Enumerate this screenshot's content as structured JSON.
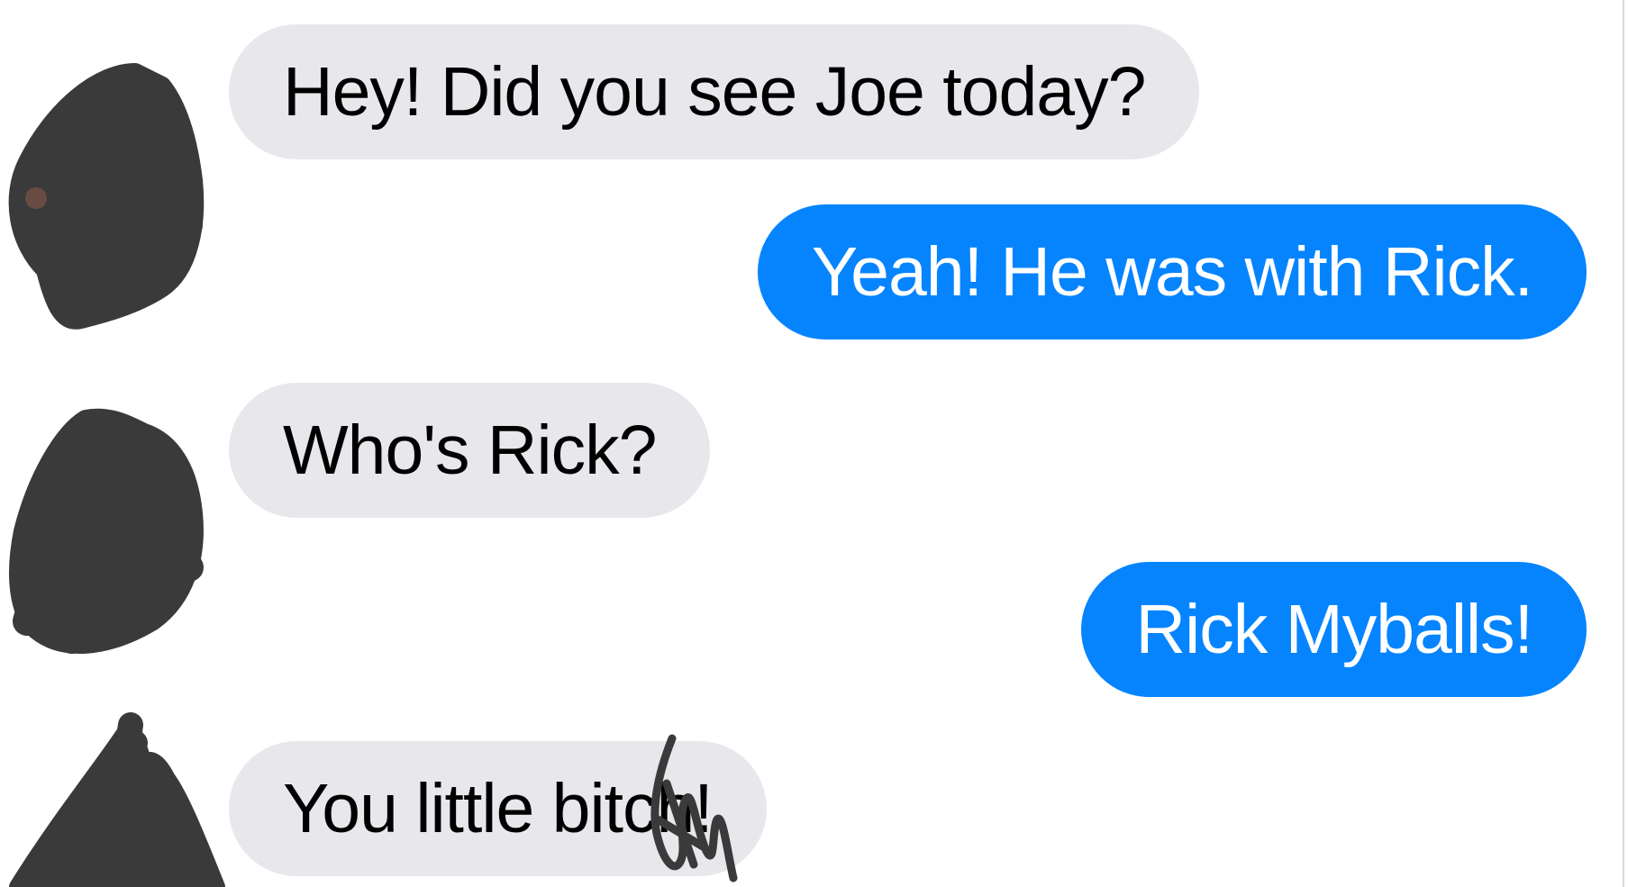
{
  "colors": {
    "background": "#ffffff",
    "incoming_bubble": "#e8e8ec",
    "outgoing_bubble": "#0584fe",
    "scribble": "#3a3a3a"
  },
  "messages": [
    {
      "sender": "contact",
      "text": "Hey! Did you see Joe today?"
    },
    {
      "sender": "me",
      "text": "Yeah! He was with Rick."
    },
    {
      "sender": "contact",
      "text": "Who's Rick?"
    },
    {
      "sender": "me",
      "text": "Rick Myballs!"
    },
    {
      "sender": "contact",
      "text": "You little bitch!"
    }
  ],
  "avatars": [
    {
      "icon": "redacted-avatar-icon"
    },
    {
      "icon": "redacted-avatar-icon"
    },
    {
      "icon": "redacted-avatar-icon"
    }
  ]
}
